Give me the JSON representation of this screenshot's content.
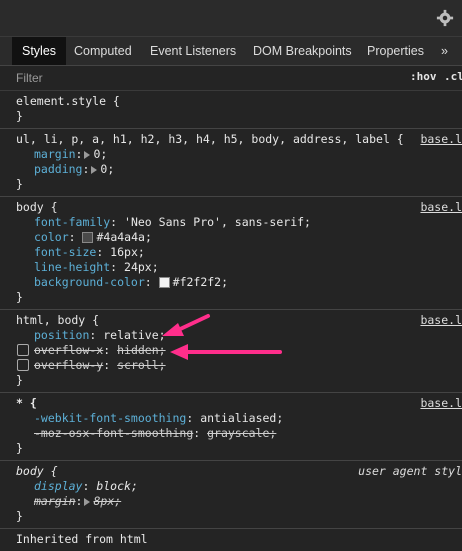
{
  "tabs": [
    {
      "label": "Styles",
      "active": true
    },
    {
      "label": "Computed"
    },
    {
      "label": "Event Listeners"
    },
    {
      "label": "DOM Breakpoints"
    },
    {
      "label": "Properties"
    },
    {
      "label": "»"
    }
  ],
  "filter": {
    "placeholder": "Filter",
    "hov": ":hov",
    "cls": ".cl"
  },
  "rules": [
    {
      "selector": "element.style {",
      "source": "",
      "decls": []
    },
    {
      "selector": "ul, li, p, a, h1, h2, h3, h4, h5, body, address, label {",
      "source": "base.l",
      "decls": [
        {
          "prop": "margin",
          "val": "0;"
        },
        {
          "prop": "padding",
          "val": "0;"
        }
      ]
    },
    {
      "selector": "body {",
      "source": "base.l",
      "decls": [
        {
          "prop": "font-family",
          "val": "'Neo Sans Pro', sans-serif;"
        },
        {
          "prop": "color",
          "val": "#4a4a4a;",
          "swatch": "#4a4a4a"
        },
        {
          "prop": "font-size",
          "val": "16px;"
        },
        {
          "prop": "line-height",
          "val": "24px;"
        },
        {
          "prop": "background-color",
          "val": "#f2f2f2;",
          "swatch": "#f2f2f2"
        }
      ]
    },
    {
      "selector": "html, body {",
      "source": "base.l",
      "decls": [
        {
          "prop": "position",
          "val": "relative;"
        },
        {
          "prop": "overflow-x",
          "val": "hidden;"
        },
        {
          "prop": "overflow-y",
          "val": "scroll;"
        }
      ]
    },
    {
      "selector": "* {",
      "source": "base.l",
      "decls": [
        {
          "prop": "-webkit-font-smoothing",
          "val": "antialiased;"
        },
        {
          "prop": "-moz-osx-font-smoothing",
          "val": "grayscale;"
        }
      ]
    },
    {
      "selector": "body {",
      "source": "user agent styl",
      "decls": [
        {
          "prop": "display",
          "val": "block;"
        },
        {
          "prop": "margin",
          "val": "8px;"
        }
      ]
    },
    {
      "selector": "Inherited from html",
      "source": "",
      "decls": []
    }
  ],
  "colors": {
    "arrow": "#ff2e8b",
    "accent": "#5db0d7"
  }
}
